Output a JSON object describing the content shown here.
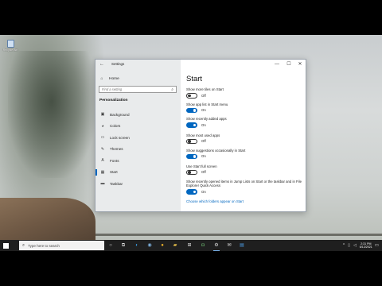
{
  "desktop": {
    "recycle_bin_label": "Recycle Bin"
  },
  "window": {
    "title": "Settings",
    "controls": {
      "minimize": "—",
      "maximize": "☐",
      "close": "✕"
    }
  },
  "sidebar": {
    "home_label": "Home",
    "search_placeholder": "Find a setting",
    "section_label": "Personalization",
    "items": [
      {
        "label": "Background",
        "icon": "image-icon"
      },
      {
        "label": "Colors",
        "icon": "palette-icon"
      },
      {
        "label": "Lock screen",
        "icon": "lock-screen-icon"
      },
      {
        "label": "Themes",
        "icon": "brush-icon"
      },
      {
        "label": "Fonts",
        "icon": "font-icon"
      },
      {
        "label": "Start",
        "icon": "start-grid-icon"
      },
      {
        "label": "Taskbar",
        "icon": "taskbar-icon"
      }
    ],
    "active_index": 5
  },
  "content": {
    "title": "Start",
    "settings": [
      {
        "desc": "Show more tiles on Start",
        "state": "Off",
        "on": false
      },
      {
        "desc": "Show app list in Start menu",
        "state": "On",
        "on": true
      },
      {
        "desc": "Show recently added apps",
        "state": "On",
        "on": true
      },
      {
        "desc": "Show most used apps",
        "state": "Off",
        "on": false
      },
      {
        "desc": "Show suggestions occasionally in Start",
        "state": "On",
        "on": true
      },
      {
        "desc": "Use Start full screen",
        "state": "Off",
        "on": false
      },
      {
        "desc": "Show recently opened items in Jump Lists on Start or the taskbar and in File Explorer Quick Access",
        "state": "On",
        "on": true
      }
    ],
    "link": "Choose which folders appear on Start"
  },
  "taskbar": {
    "search_placeholder": "Type here to search",
    "clock_time": "2:31 PM",
    "clock_date": "6/13/2021",
    "accent": "#0067c0"
  }
}
